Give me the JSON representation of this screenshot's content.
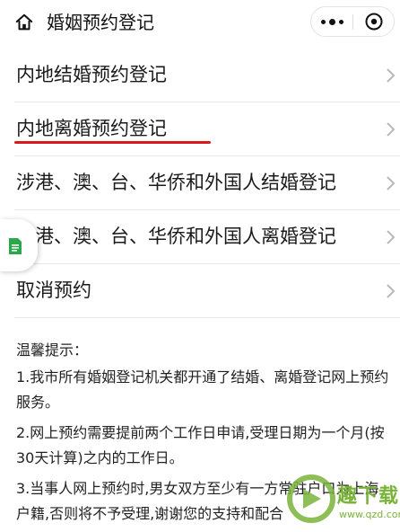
{
  "header": {
    "title": "婚姻预约登记",
    "home_icon": "home-icon",
    "more_icon": "more-dots-icon",
    "close_icon": "close-target-icon"
  },
  "menu": {
    "items": [
      {
        "label": "内地结婚预约登记"
      },
      {
        "label": "内地离婚预约登记"
      },
      {
        "label": "涉港、澳、台、华侨和外国人结婚登记"
      },
      {
        "label": "涉港、澳、台、华侨和外国人离婚登记"
      },
      {
        "label": "取消预约"
      }
    ],
    "highlight_color": "#d9191c"
  },
  "tips": {
    "heading": "温馨提示：",
    "items": [
      "1.我市所有婚姻登记机关都开通了结婚、离婚登记网上预约服务。",
      "2.网上预约需要提前两个工作日申请,受理日期为一个月(按30天计算)之内的工作日。",
      "3.当事人网上预约时,男女双方至少有一方常驻户口为上海户籍,否则将不予受理,谢谢您的支持和配合"
    ]
  },
  "watermark": {
    "text": "趣下载",
    "url": "www.qzd.com",
    "color": "#7ab33a"
  }
}
